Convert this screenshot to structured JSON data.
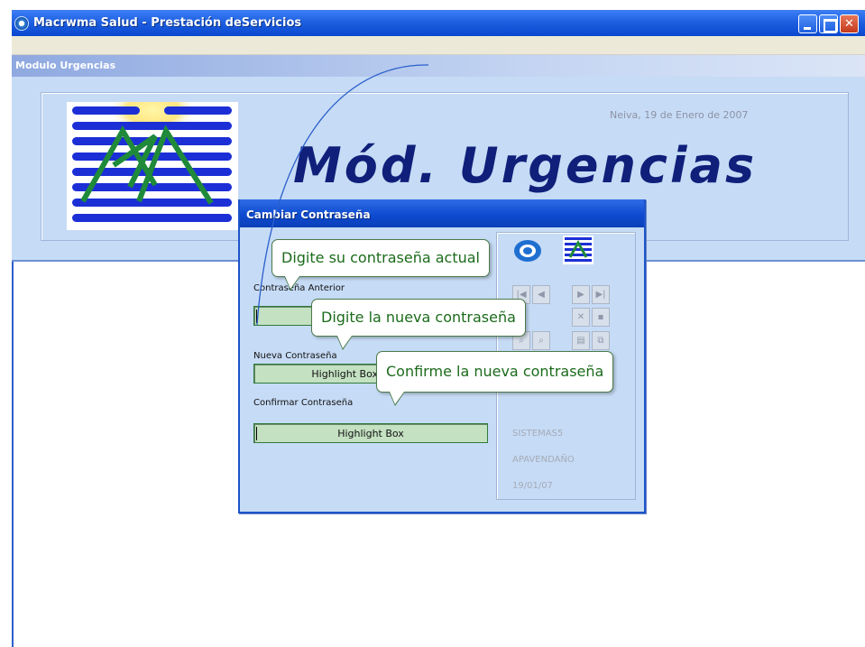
{
  "window": {
    "title": "Macrwma Salud - Prestación deServicios",
    "minimize_icon": "minimize-icon",
    "maximize_icon": "maximize-icon",
    "close_icon": "close-icon"
  },
  "module": {
    "label": "Modulo  Urgencias"
  },
  "banner": {
    "date": "Neiva, 19 de Enero de 2007",
    "title": "Mód. Urgencias",
    "logo_icon": "logo-mountains-stripes"
  },
  "dialog": {
    "title": "Cambiar Contraseña",
    "fields": {
      "old_password_label": "Contraseña Anterior",
      "new_password_label": "Nueva Contraseña",
      "confirm_password_label": "Confirmar Contraseña",
      "highlight_text": "Highlight Box"
    },
    "nav_icons": [
      "first-record-icon",
      "prev-record-icon",
      "next-record-icon",
      "last-record-icon",
      "cancel-icon",
      "save-icon",
      "find-icon",
      "find-next-icon",
      "print-icon",
      "copy-icon"
    ],
    "status": {
      "system": "SISTEMAS5",
      "user": "APAVENDAÑO",
      "date": "19/01/07"
    }
  },
  "tooltips": {
    "current_password": "Digite su contraseña actual",
    "new_password": "Digite la nueva contraseña",
    "confirm_password": "Confirme la nueva contraseña"
  },
  "colors": {
    "titlebar": "#0a48cf",
    "background": "#c6dbf5",
    "field": "#c4e1c2",
    "tooltip_text": "#1b6b1b",
    "title_text": "#0f1f7a"
  }
}
